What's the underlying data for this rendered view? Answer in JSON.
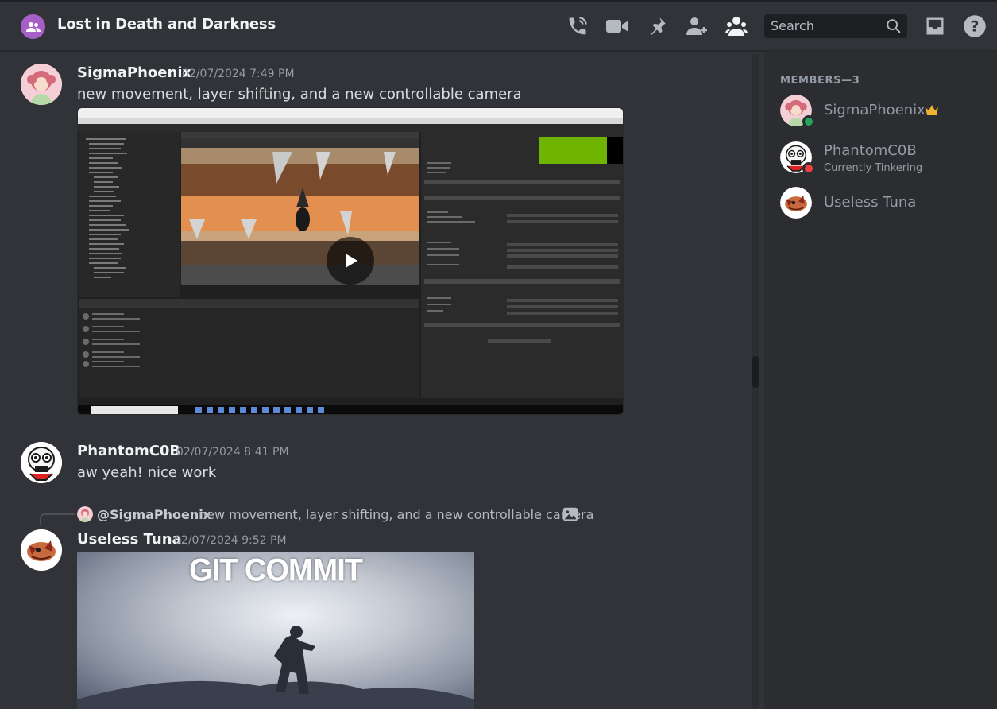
{
  "header": {
    "title": "Lost in Death and Darkness",
    "search_placeholder": "Search",
    "icons": [
      "group-dm-icon",
      "voice-call-icon",
      "video-call-icon",
      "pin-icon",
      "add-friend-icon",
      "members-list-icon",
      "search-icon",
      "inbox-icon",
      "help-icon"
    ]
  },
  "messages": [
    {
      "username": "SigmaPhoenix",
      "timestamp": "02/07/2024 7:49 PM",
      "text": "new movement, layer shifting, and a new controllable camera",
      "attachment": "video"
    },
    {
      "username": "PhantomC0B",
      "timestamp": "02/07/2024 8:41 PM",
      "text": "aw yeah! nice work"
    },
    {
      "reply": {
        "mention": "@SigmaPhoenix",
        "text": "new movement, layer shifting, and a new controllable camera"
      },
      "username": "Useless Tuna",
      "timestamp": "02/07/2024 9:52 PM",
      "gif_caption": "GIT COMMIT"
    }
  ],
  "members": {
    "header": "MEMBERS—3",
    "list": [
      {
        "name": "SigmaPhoenix",
        "status": "online",
        "badge": "crown-icon"
      },
      {
        "name": "PhantomC0B",
        "status": "dnd",
        "activity": "Currently Tinkering"
      },
      {
        "name": "Useless Tuna",
        "status": "offline"
      }
    ]
  },
  "colors": {
    "background": "#313338",
    "sidebar": "#2b2d31",
    "online": "#23a55a",
    "dnd": "#f23f43",
    "crown": "#f0b232",
    "group_icon": "#a55fc6"
  }
}
